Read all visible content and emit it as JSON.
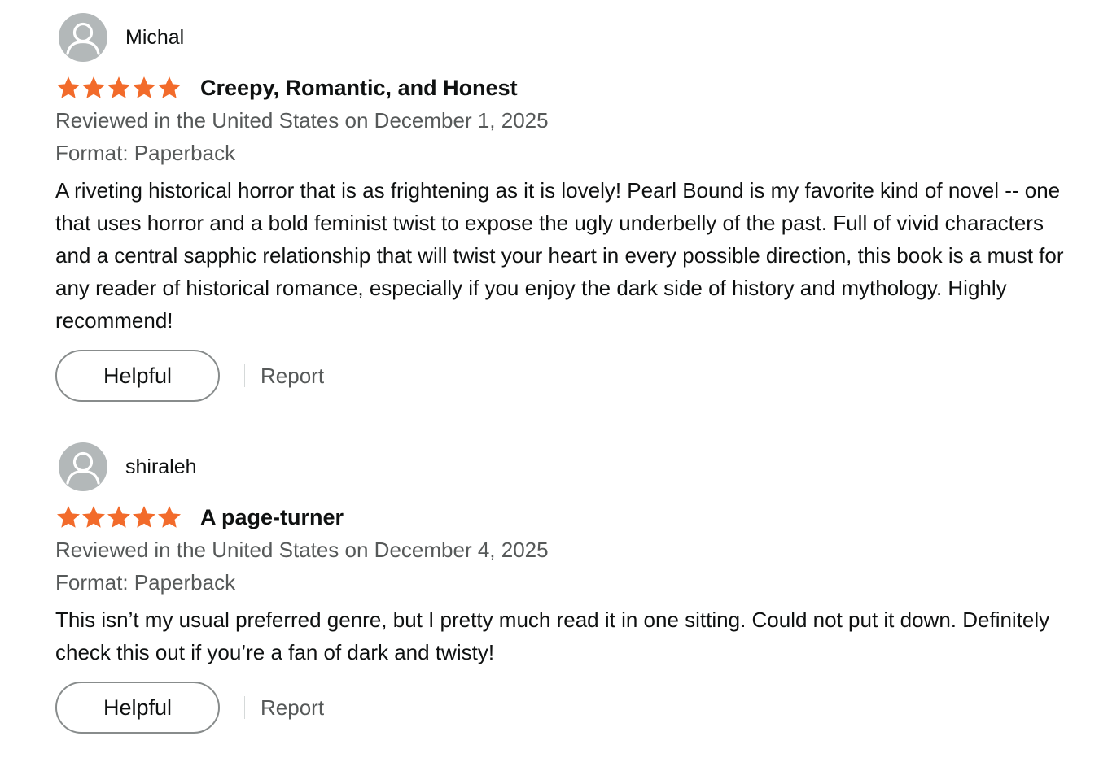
{
  "colors": {
    "star": "#f26b2b",
    "avatar_bg": "#b3b8b9",
    "text_primary": "#0f1111",
    "text_secondary": "#565959",
    "button_border": "#888c8c"
  },
  "reviews": [
    {
      "profile_name": "Michal",
      "avatar_icon": "person-silhouette-icon",
      "rating": 5,
      "rating_max": 5,
      "title": "Creepy, Romantic, and Honest",
      "date": "Reviewed in the United States on December 1, 2025",
      "format": "Format: Paperback",
      "body": "A riveting historical horror that is as frightening as it is lovely! Pearl Bound is my favorite kind of novel -- one that uses horror and a bold feminist twist to expose the ugly underbelly of the past. Full of vivid characters and a central sapphic relationship that will twist your heart in every possible direction, this book is a must for any reader of historical romance, especially if you enjoy the dark side of history and mythology. Highly recommend!",
      "helpful_label": "Helpful",
      "report_label": "Report"
    },
    {
      "profile_name": "shiraleh",
      "avatar_icon": "person-silhouette-icon",
      "rating": 5,
      "rating_max": 5,
      "title": "A page-turner",
      "date": "Reviewed in the United States on December 4, 2025",
      "format": "Format: Paperback",
      "body": "This isn’t my usual preferred genre, but I pretty much read it in one sitting. Could not put it down. Definitely check this out if you’re a fan of dark and twisty!",
      "helpful_label": "Helpful",
      "report_label": "Report"
    }
  ]
}
